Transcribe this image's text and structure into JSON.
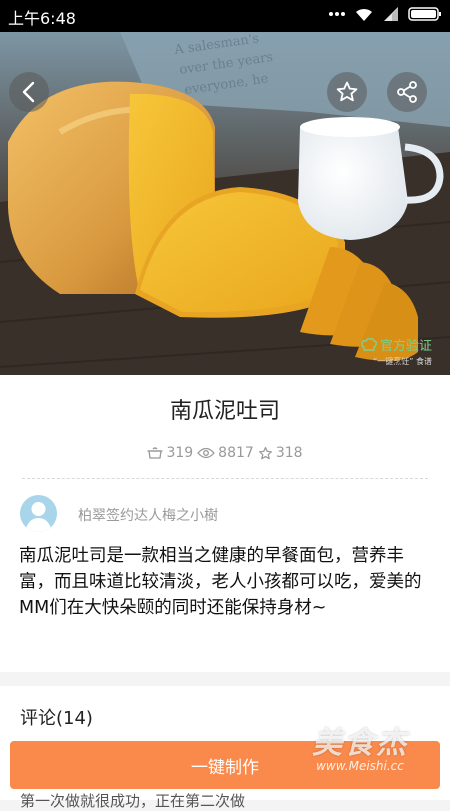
{
  "status_bar": {
    "time": "上午6:48"
  },
  "hero": {
    "verified_label": "官方验证",
    "verified_sub": "“一键烹饪” 食谱",
    "accent": "#7fd08a"
  },
  "recipe": {
    "title": "南瓜泥吐司",
    "stats": {
      "made": "319",
      "views": "8817",
      "favorites": "318"
    },
    "author": "柏翠签约达人梅之小樹",
    "description": "南瓜泥吐司是一款相当之健康的早餐面包，营养丰富，而且味道比较清淡，老人小孩都可以吃，爱美的MM们在大快朵颐的同时还能保持身材~"
  },
  "comments": {
    "title": "评论(14)",
    "first_comment_peek": "第一次做就很成功，正在第二次做"
  },
  "action": {
    "make_label": "一键制作",
    "color": "#f98a4b"
  },
  "watermark": {
    "brand": "美食杰",
    "url": "www.Meishi.cc"
  }
}
